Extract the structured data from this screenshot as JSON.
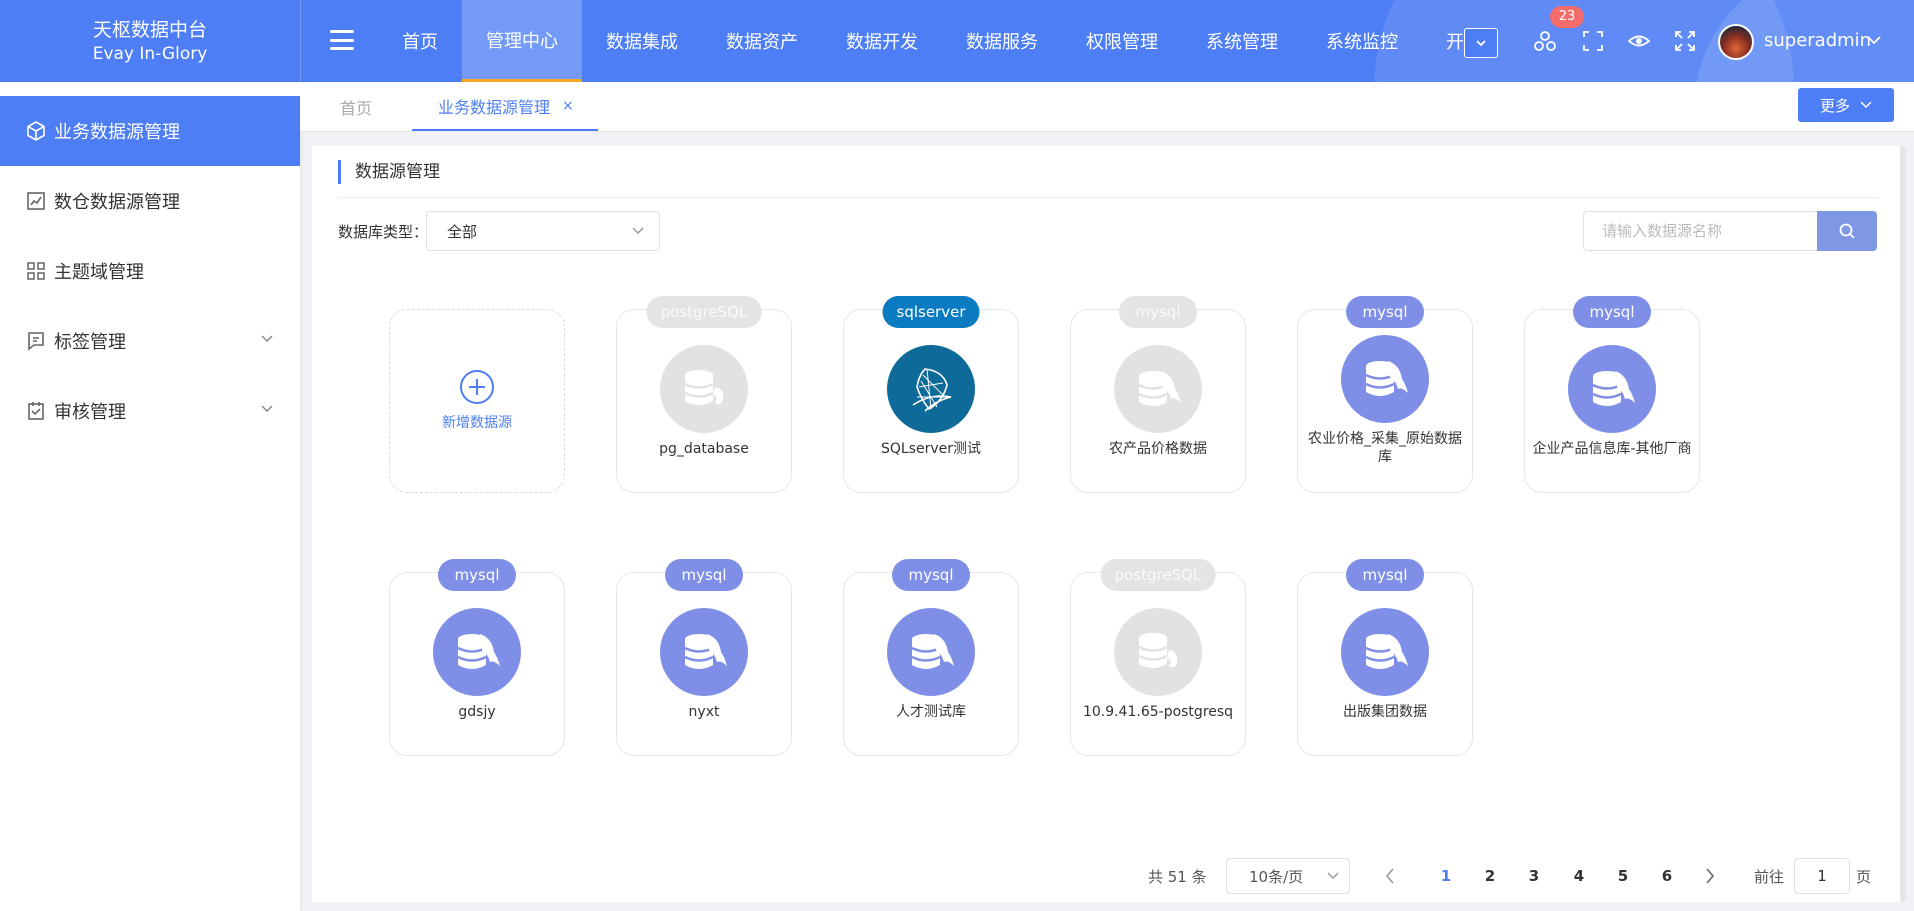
{
  "brand": {
    "title": "天枢数据中台",
    "subtitle": "Evay In-Glory"
  },
  "nav": {
    "items": [
      "首页",
      "管理中心",
      "数据集成",
      "数据资产",
      "数据开发",
      "数据服务",
      "权限管理",
      "系统管理",
      "系统监控",
      "开发"
    ],
    "active_index": 1
  },
  "header": {
    "notification_count": "23",
    "username": "superadmin"
  },
  "sidebar": {
    "items": [
      {
        "label": "业务数据源管理",
        "icon": "cube-icon",
        "active": true
      },
      {
        "label": "数仓数据源管理",
        "icon": "chart-icon"
      },
      {
        "label": "主题域管理",
        "icon": "grid-icon"
      },
      {
        "label": "标签管理",
        "icon": "tag-icon",
        "expandable": true
      },
      {
        "label": "审核管理",
        "icon": "audit-icon",
        "expandable": true
      }
    ]
  },
  "tabs": {
    "home": "首页",
    "current": "业务数据源管理",
    "close": "×",
    "more": "更多"
  },
  "main": {
    "section_title": "数据源管理",
    "filter_label": "数据库类型：",
    "filter_value": "全部",
    "search_placeholder": "请输入数据源名称",
    "add_label": "新增数据源",
    "datasources": [
      {
        "tag": "postgreSQL",
        "name": "pg_database",
        "style": "gray"
      },
      {
        "tag": "sqlserver",
        "name": "SQLserver测试",
        "style": "blue"
      },
      {
        "tag": "mysql",
        "name": "农产品价格数据",
        "style": "gray"
      },
      {
        "tag": "mysql",
        "name": "农业价格_采集_原始数据库",
        "style": "purple"
      },
      {
        "tag": "mysql",
        "name": "企业产品信息库-其他厂商",
        "style": "purple"
      },
      {
        "tag": "mysql",
        "name": "gdsjy",
        "style": "purple"
      },
      {
        "tag": "mysql",
        "name": "nyxt",
        "style": "purple"
      },
      {
        "tag": "mysql",
        "name": "人才测试库",
        "style": "purple"
      },
      {
        "tag": "postgreSQL",
        "name": "10.9.41.65-postgresq",
        "style": "gray"
      },
      {
        "tag": "mysql",
        "name": "出版集团数据",
        "style": "purple"
      }
    ]
  },
  "pagination": {
    "total_text": "共 51 条",
    "page_size": "10条/页",
    "pages": [
      "1",
      "2",
      "3",
      "4",
      "5",
      "6"
    ],
    "current_page": "1",
    "goto_label": "前往",
    "goto_value": "1",
    "page_unit": "页"
  },
  "colors": {
    "primary": "#4e7ef5",
    "mysql_purple": "#7f8ee6",
    "sqlserver_blue": "#0a7bc0",
    "disabled_gray": "#e4e4e4",
    "badge_red": "#f56c6c"
  }
}
